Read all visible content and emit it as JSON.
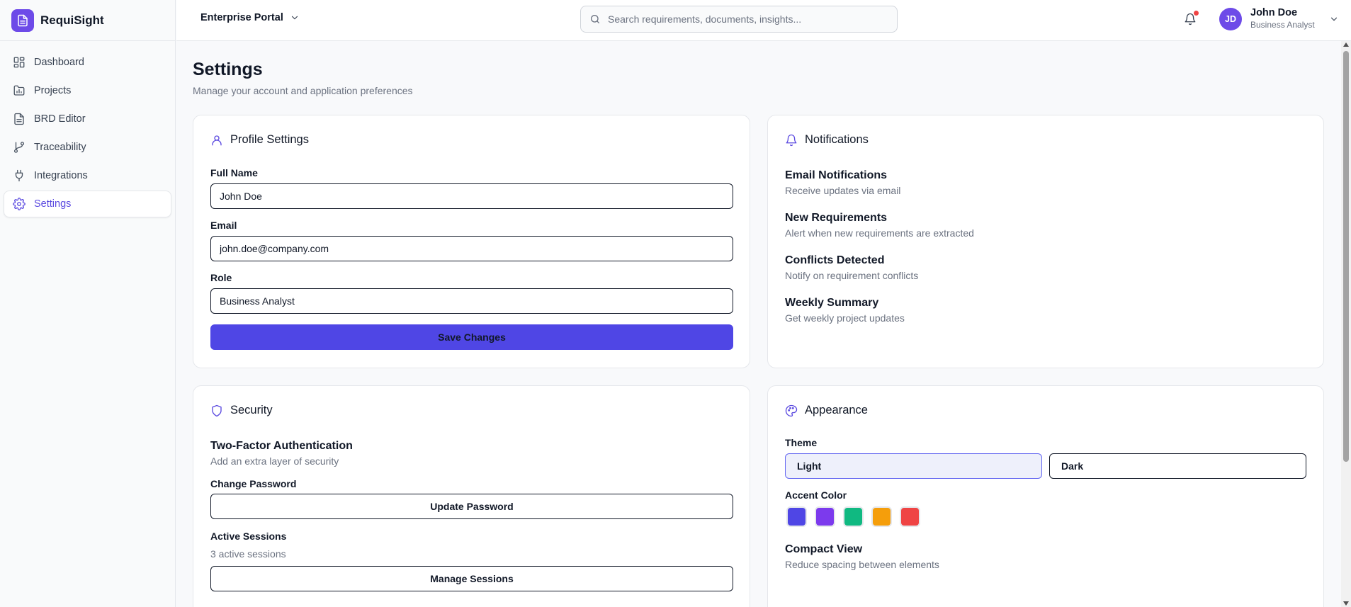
{
  "brand": {
    "name": "RequiSight"
  },
  "sidebar": {
    "items": [
      {
        "label": "Dashboard",
        "icon": "dashboard-grid-icon"
      },
      {
        "label": "Projects",
        "icon": "folder-chart-icon"
      },
      {
        "label": "BRD Editor",
        "icon": "document-icon"
      },
      {
        "label": "Traceability",
        "icon": "git-branch-icon"
      },
      {
        "label": "Integrations",
        "icon": "plug-icon"
      },
      {
        "label": "Settings",
        "icon": "gear-icon",
        "active": true
      }
    ]
  },
  "header": {
    "portal": "Enterprise Portal",
    "search_placeholder": "Search requirements, documents, insights...",
    "notification_unread": true,
    "user": {
      "initials": "JD",
      "name": "John Doe",
      "role": "Business Analyst"
    }
  },
  "page": {
    "title": "Settings",
    "subtitle": "Manage your account and application preferences"
  },
  "profile": {
    "title": "Profile Settings",
    "full_name_label": "Full Name",
    "full_name": "John Doe",
    "email_label": "Email",
    "email": "john.doe@company.com",
    "role_label": "Role",
    "role": "Business Analyst",
    "save_label": "Save Changes"
  },
  "notifications": {
    "title": "Notifications",
    "items": [
      {
        "title": "Email Notifications",
        "desc": "Receive updates via email"
      },
      {
        "title": "New Requirements",
        "desc": "Alert when new requirements are extracted"
      },
      {
        "title": "Conflicts Detected",
        "desc": "Notify on requirement conflicts"
      },
      {
        "title": "Weekly Summary",
        "desc": "Get weekly project updates"
      }
    ]
  },
  "security": {
    "title": "Security",
    "two_factor_title": "Two-Factor Authentication",
    "two_factor_desc": "Add an extra layer of security",
    "change_password_label": "Change Password",
    "update_password_label": "Update Password",
    "active_sessions_label": "Active Sessions",
    "active_sessions_count": "3 active sessions",
    "manage_sessions_label": "Manage Sessions"
  },
  "appearance": {
    "title": "Appearance",
    "theme_label": "Theme",
    "theme_options": [
      "Light",
      "Dark"
    ],
    "selected_theme": "Light",
    "accent_label": "Accent Color",
    "accent_colors": [
      "#4f46e5",
      "#7c3aed",
      "#10b981",
      "#f59e0b",
      "#ef4444"
    ],
    "compact_title": "Compact View",
    "compact_desc": "Reduce spacing between elements"
  },
  "colors": {
    "brand": "#6d4ae8",
    "primary": "#4f46e5",
    "active_nav": "#5b4ae0",
    "badge": "#ef4444"
  }
}
